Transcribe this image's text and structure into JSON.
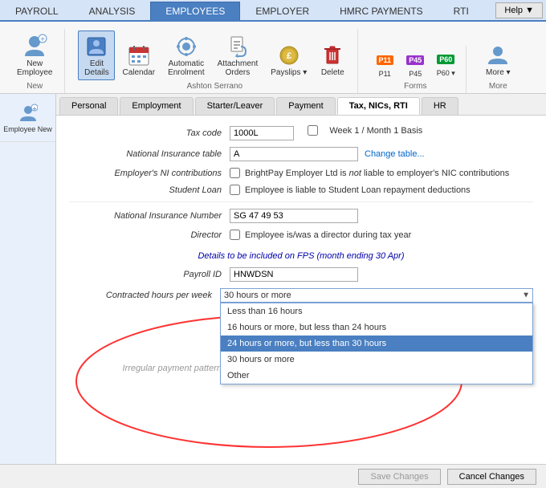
{
  "nav": {
    "tabs": [
      "PAYROLL",
      "ANALYSIS",
      "EMPLOYEES",
      "EMPLOYER",
      "HMRC PAYMENTS",
      "RTI"
    ],
    "active": "EMPLOYEES",
    "help_label": "Help ▼"
  },
  "ribbon": {
    "groups": [
      {
        "label": "New",
        "items": [
          {
            "id": "new-employee",
            "icon": "👤",
            "label": "New\nEmployee",
            "active": false
          }
        ]
      },
      {
        "label": "Ashton Serrano",
        "items": [
          {
            "id": "edit-details",
            "icon": "✏️",
            "label": "Edit\nDetails",
            "active": true
          },
          {
            "id": "calendar",
            "icon": "📅",
            "label": "Calendar",
            "active": false
          },
          {
            "id": "auto-enrol",
            "icon": "⚙️",
            "label": "Automatic\nEnrolment",
            "active": false
          },
          {
            "id": "attach-orders",
            "icon": "📎",
            "label": "Attachment\nOrders",
            "active": false
          },
          {
            "id": "payslips",
            "icon": "🪙",
            "label": "Payslips",
            "active": false
          },
          {
            "id": "delete",
            "icon": "🗑️",
            "label": "Delete",
            "active": false
          }
        ]
      },
      {
        "label": "Forms",
        "items": [
          {
            "id": "p11",
            "badge": "P11",
            "badge_color": "#ff6600",
            "label": "P11"
          },
          {
            "id": "p45",
            "badge": "P45",
            "badge_color": "#9933cc",
            "label": "P45"
          },
          {
            "id": "p60",
            "badge": "P60",
            "badge_color": "#009933",
            "label": "P60"
          }
        ]
      },
      {
        "label": "More",
        "items": [
          {
            "id": "more",
            "icon": "👤",
            "label": "More",
            "has_arrow": true
          }
        ]
      }
    ]
  },
  "sidebar": {
    "items": [
      {
        "id": "employee-new",
        "label": "Employee New",
        "active": false
      }
    ]
  },
  "sub_tabs": {
    "tabs": [
      "Personal",
      "Employment",
      "Starter/Leaver",
      "Payment",
      "Tax, NICs, RTI",
      "HR"
    ],
    "active": "Tax, NICs, RTI"
  },
  "form": {
    "tax_code_label": "Tax code",
    "tax_code_value": "1000L",
    "week1_month1_label": "Week 1 / Month 1 Basis",
    "ni_table_label": "National Insurance table",
    "ni_table_value": "A",
    "change_table_label": "Change table...",
    "employer_ni_label": "Employer's NI contributions",
    "employer_ni_checkbox_label": "BrightPay Employer Ltd is not liable to employer's NIC contributions",
    "not_italic": "not",
    "student_loan_label": "Student Loan",
    "student_loan_checkbox_label": "Employee is liable to Student Loan repayment deductions",
    "ni_number_label": "National Insurance Number",
    "ni_number_value": "SG 47 49 53",
    "director_label": "Director",
    "director_checkbox_label": "Employee is/was a director during tax year",
    "fps_section_label": "Details to be included on FPS (month ending 30 Apr)",
    "payroll_id_label": "Payroll ID",
    "payroll_id_value": "HNWDSN",
    "contracted_hours_label": "Contracted hours per week",
    "contracted_hours_selected": "30 hours or more",
    "irregular_payment_label": "Irregular payment pattern",
    "dropdown_options": [
      "Less than 16 hours",
      "16 hours or more, but less than 24 hours",
      "24 hours or more, but less than 30 hours",
      "30 hours or more",
      "Other"
    ],
    "dropdown_selected_index": 2
  },
  "bottom_bar": {
    "save_label": "Save Changes",
    "cancel_label": "Cancel Changes"
  }
}
